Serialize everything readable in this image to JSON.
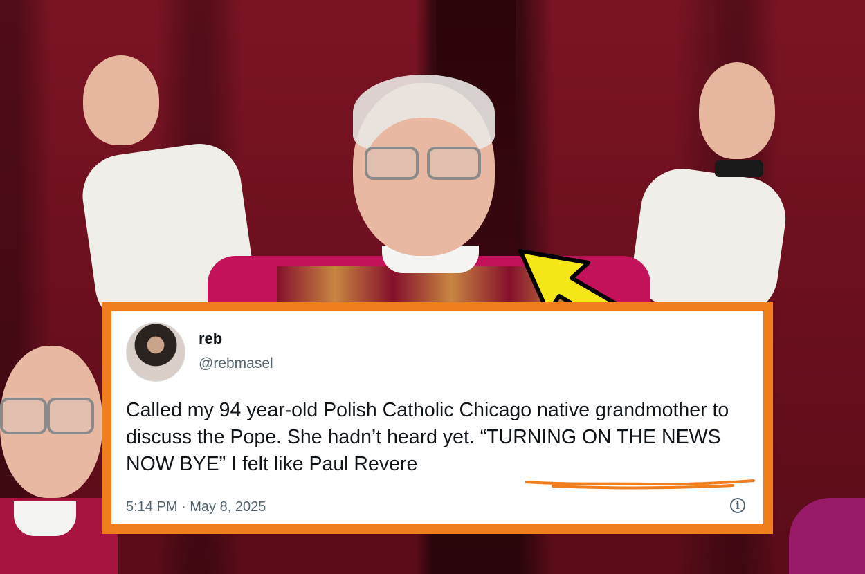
{
  "tweet": {
    "name": "reb",
    "handle": "@rebmasel",
    "text_main": "Called my 94 year-old Polish Catholic Chicago native grandmother to discuss the Pope. She hadn’t heard yet. “TURNING ON THE NEWS NOW BYE” ",
    "text_highlight": "I felt like Paul Revere",
    "timestamp": "5:14 PM · May 8, 2025",
    "info_icon": "info-circle-icon"
  },
  "colors": {
    "frame_orange": "#f07e1d",
    "arrow_yellow": "#f5e617",
    "underline_orange": "#f07e1d",
    "curtain_red": "#6e0f1c"
  }
}
